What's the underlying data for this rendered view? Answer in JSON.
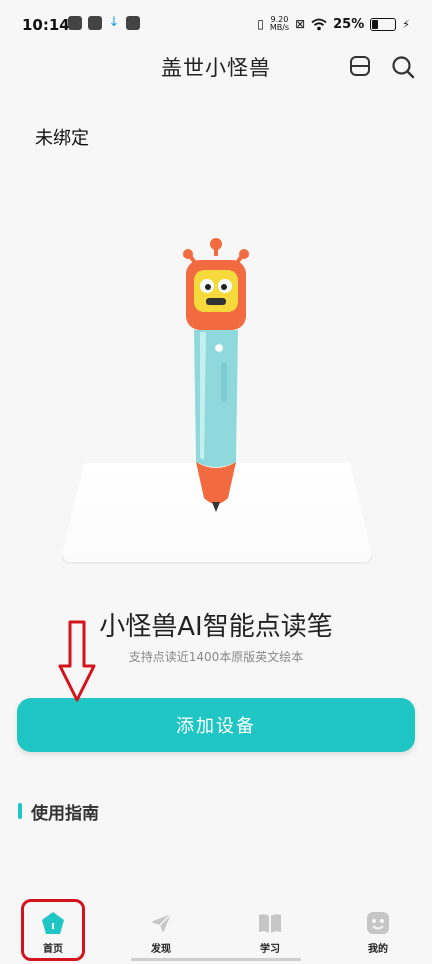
{
  "status_bar": {
    "time": "10:14",
    "net_speed_value": "9.20",
    "net_speed_unit": "MB/s",
    "battery": "25%"
  },
  "header": {
    "title": "盖世小怪兽",
    "icons": [
      "device-switch-icon",
      "search-icon"
    ]
  },
  "device_status": "未绑定",
  "product": {
    "title": "小怪兽AI智能点读笔",
    "subtitle": "支持点读近1400本原版英文绘本"
  },
  "add_device_label": "添加设备",
  "guide_section_title": "使用指南",
  "bottom_nav": {
    "items": [
      {
        "label": "首页",
        "icon": "home-icon",
        "active": true
      },
      {
        "label": "发现",
        "icon": "send-icon",
        "active": false
      },
      {
        "label": "学习",
        "icon": "book-icon",
        "active": false
      },
      {
        "label": "我的",
        "icon": "face-icon",
        "active": false
      }
    ]
  },
  "colors": {
    "accent": "#1fc6c4",
    "annotation_red": "#d4141c",
    "pen_body": "#8fd9dc",
    "pen_head": "#f26a3f"
  }
}
